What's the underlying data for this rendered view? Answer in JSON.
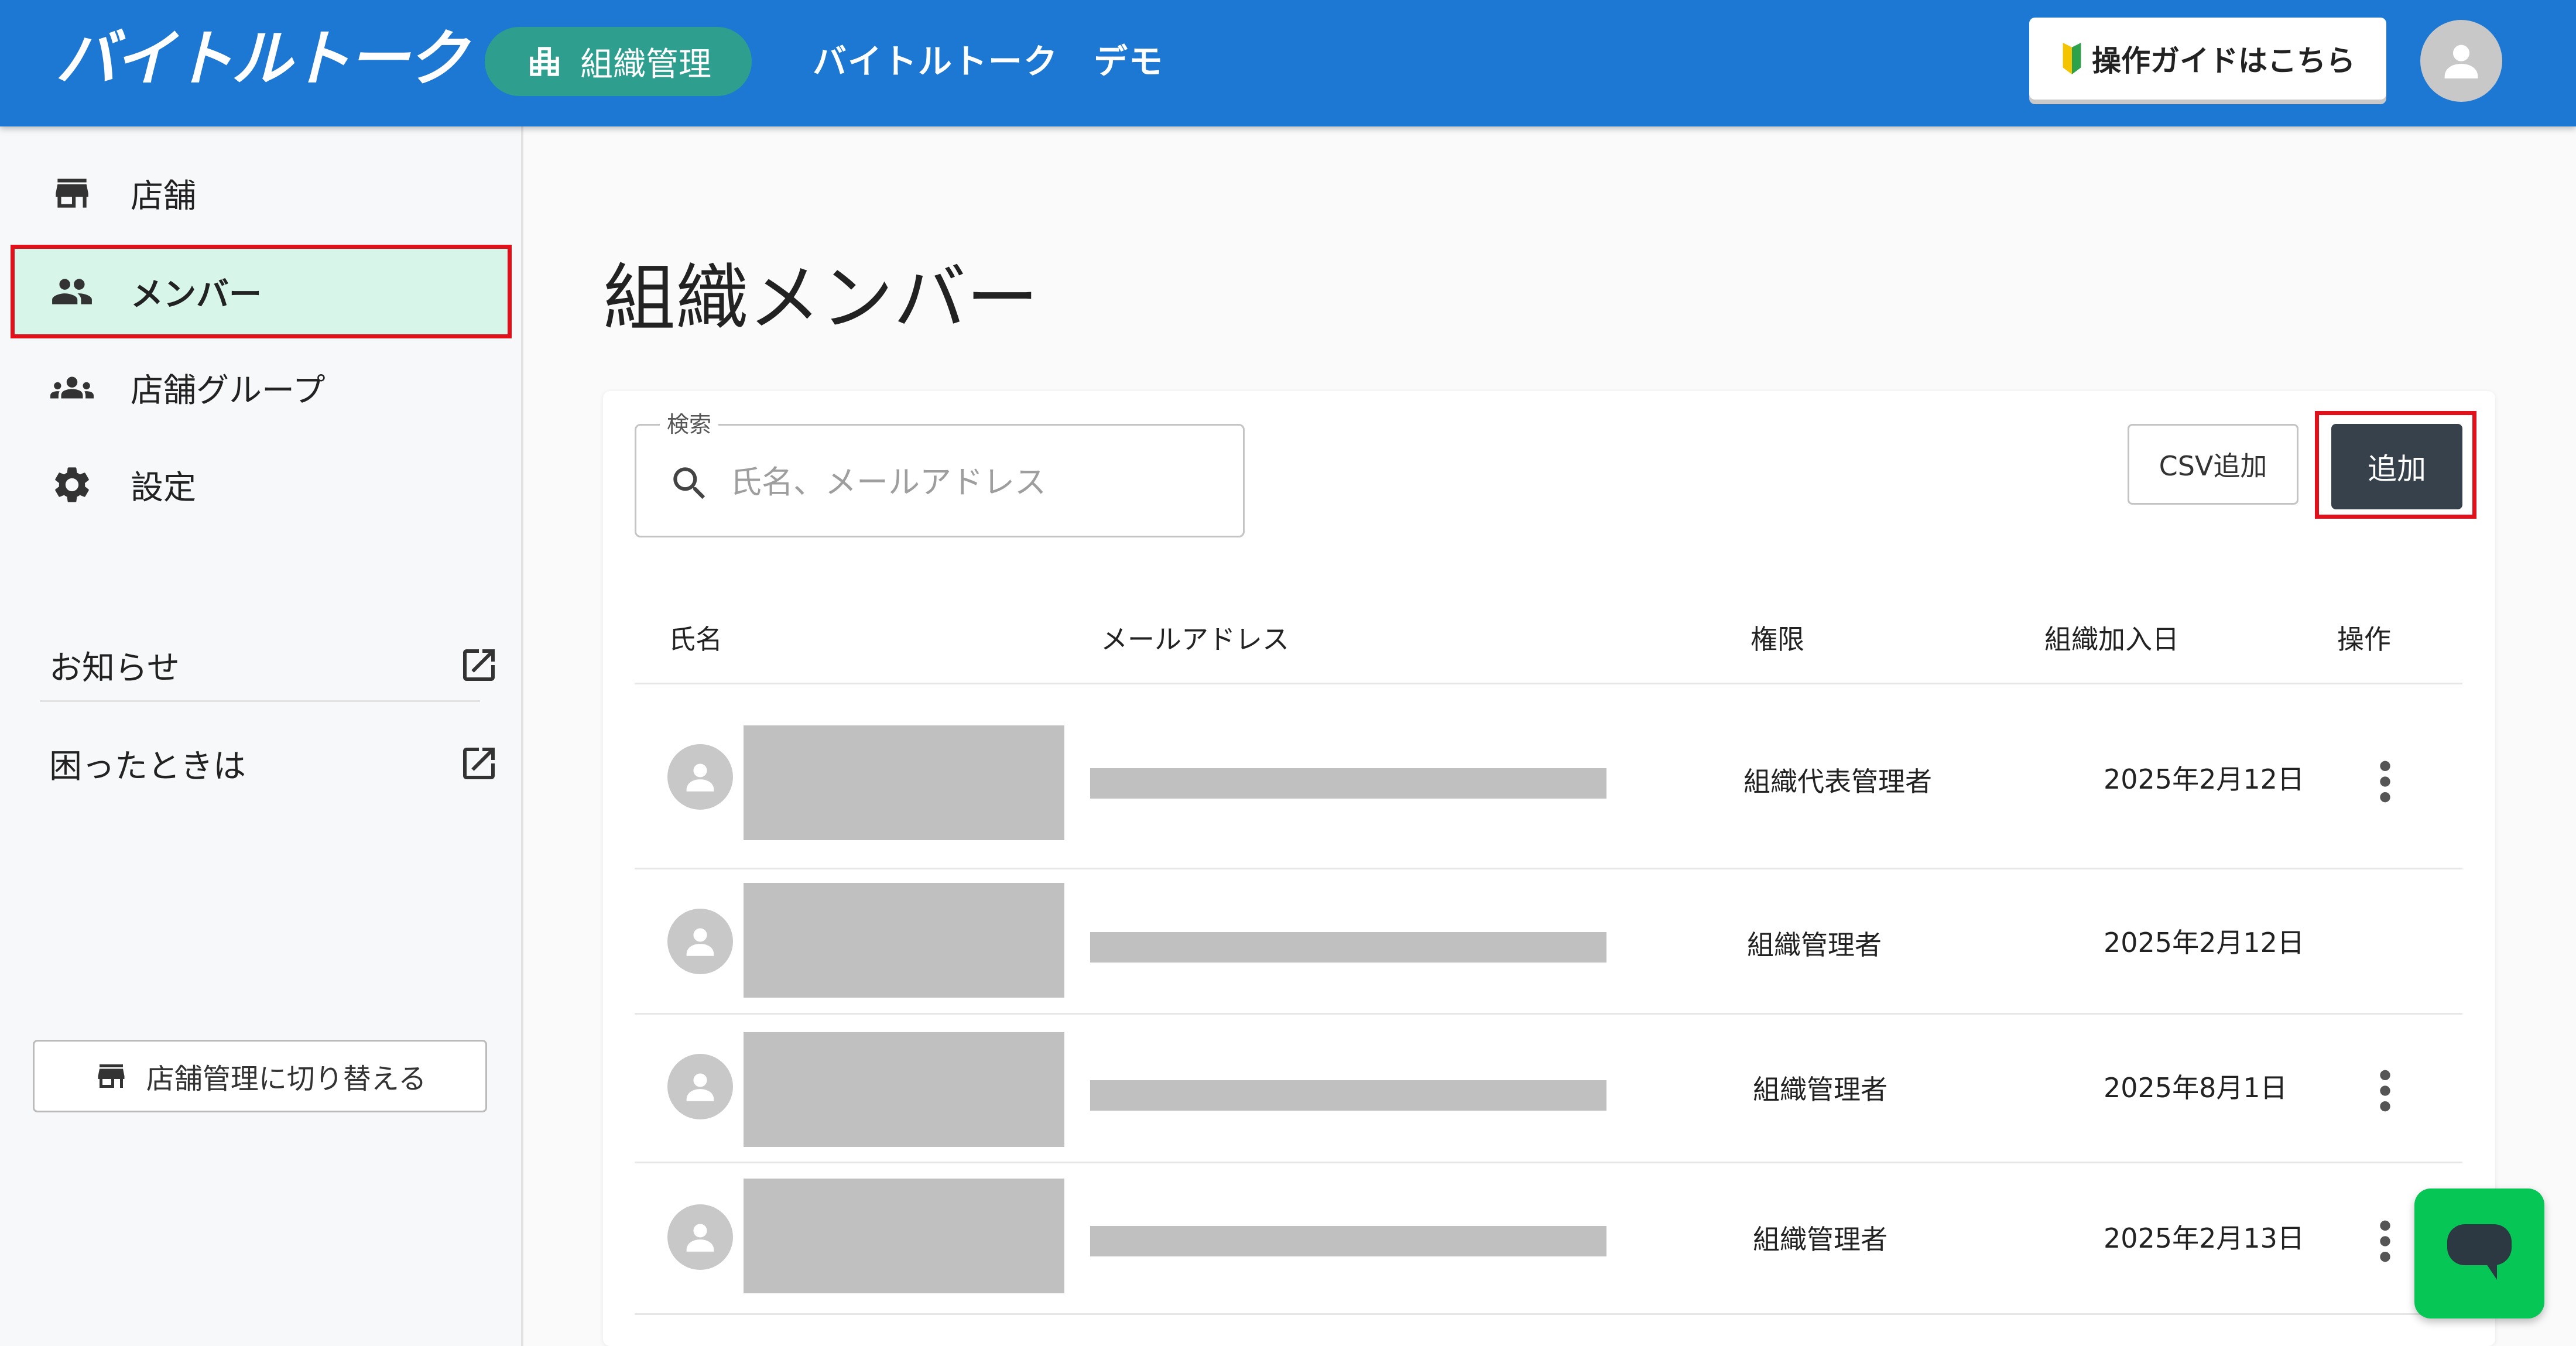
{
  "header": {
    "logo_text": "バイトルトーク",
    "org_chip_label": "組織管理",
    "org_title": "バイトルトーク　デモ",
    "guide_button_label": "操作ガイドはこちら",
    "bg_color": "#1d78d4",
    "chip_color": "#2e9e8e"
  },
  "sidebar": {
    "items": [
      {
        "label": "店舗",
        "icon": "store-icon",
        "active": false
      },
      {
        "label": "メンバー",
        "icon": "people-icon",
        "active": true
      },
      {
        "label": "店舗グループ",
        "icon": "groups-icon",
        "active": false
      },
      {
        "label": "設定",
        "icon": "gear-icon",
        "active": false
      }
    ],
    "links": [
      {
        "label": "お知らせ",
        "icon": "external-link-icon"
      },
      {
        "label": "困ったときは",
        "icon": "external-link-icon"
      }
    ],
    "switch_button_label": "店舗管理に切り替える",
    "active_bg": "#d8f5ea",
    "highlight_color": "#e0111b"
  },
  "main": {
    "title": "組織メンバー",
    "search": {
      "legend": "検索",
      "placeholder": "氏名、メールアドレス",
      "value": ""
    },
    "csv_button_label": "CSV追加",
    "add_button_label": "追加",
    "table": {
      "columns": [
        "氏名",
        "メールアドレス",
        "権限",
        "組織加入日",
        "操作"
      ],
      "rows": [
        {
          "role": "組織代表管理者",
          "joined": "2025年2月12日",
          "has_actions": true
        },
        {
          "role": "組織管理者",
          "joined": "2025年2月12日",
          "has_actions": false
        },
        {
          "role": "組織管理者",
          "joined": "2025年8月1日",
          "has_actions": true
        },
        {
          "role": "組織管理者",
          "joined": "2025年2月13日",
          "has_actions": true
        }
      ]
    }
  },
  "chat_fab": {
    "icon": "chat-bubble-icon",
    "color": "#06c755"
  }
}
